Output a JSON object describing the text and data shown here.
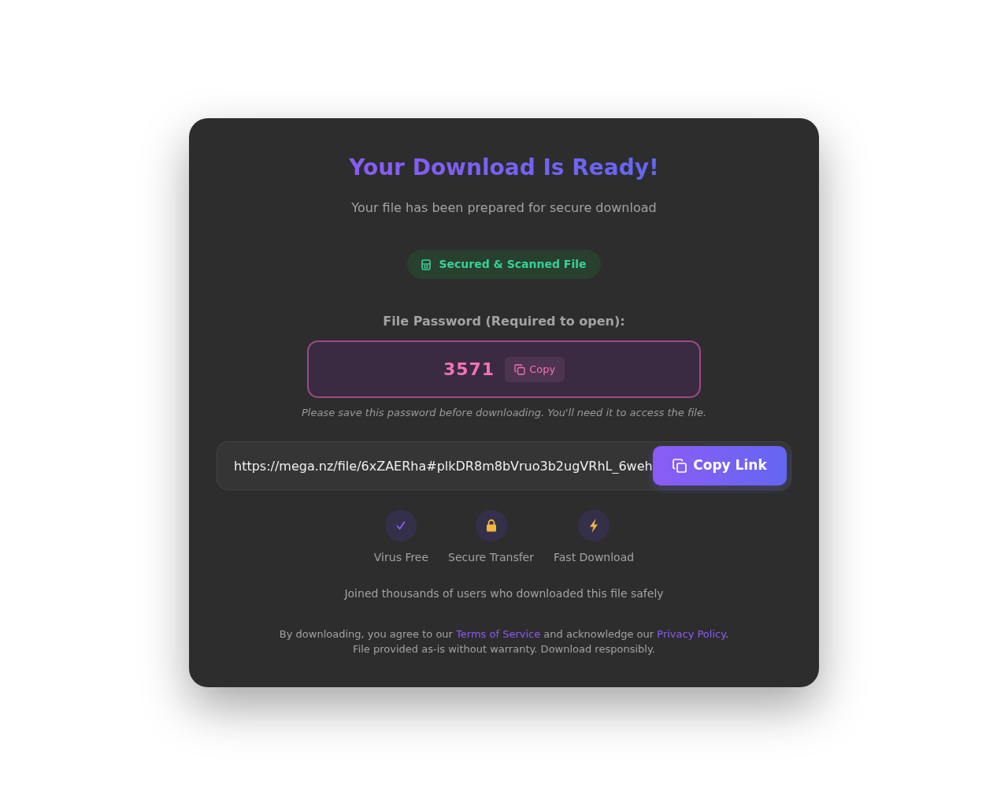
{
  "title": "Your Download Is Ready!",
  "subtitle": "Your file has been prepared for secure download",
  "badge": {
    "label": "Secured & Scanned File"
  },
  "password": {
    "label": "File Password (Required to open):",
    "value": "3571",
    "copy_button": "Copy",
    "note": "Please save this password before downloading. You'll need it to access the file."
  },
  "link": {
    "value": "https://mega.nz/file/6xZAERha#plkDR8m8bVruo3b2ugVRhL_6weh",
    "button": "Copy Link"
  },
  "features": [
    {
      "kind": "check",
      "label": "Virus Free"
    },
    {
      "kind": "lock",
      "label": "Secure Transfer"
    },
    {
      "kind": "bolt",
      "label": "Fast Download"
    }
  ],
  "social_proof": "Joined thousands of users who downloaded this file safely",
  "legal": {
    "parts": [
      {
        "kind": "text",
        "text": "By downloading, you agree to our "
      },
      {
        "kind": "link",
        "text": "Terms of Service"
      },
      {
        "kind": "text",
        "text": " and acknowledge our "
      },
      {
        "kind": "link",
        "text": "Privacy Policy"
      },
      {
        "kind": "text",
        "text": "."
      }
    ],
    "disclaimer": "File provided as-is without warranty. Download responsibly."
  }
}
